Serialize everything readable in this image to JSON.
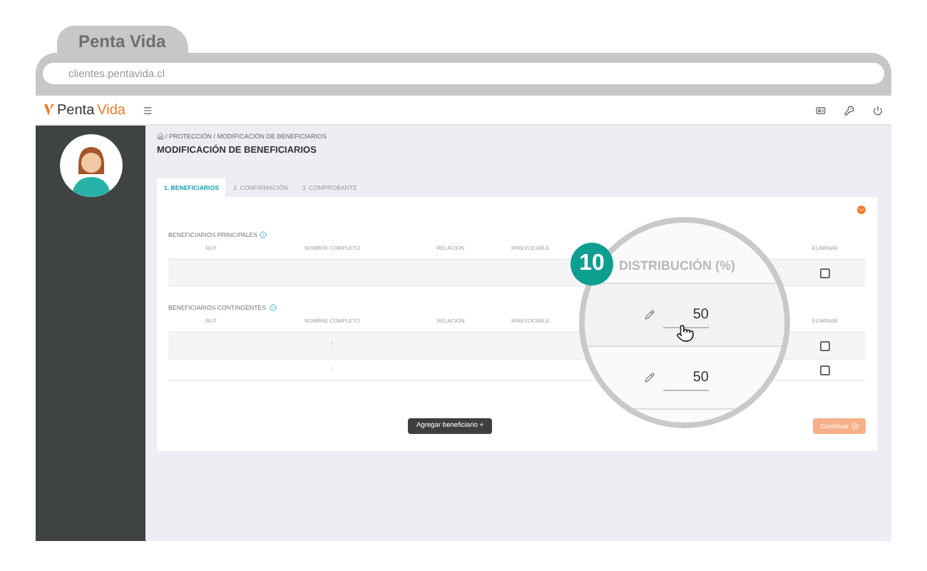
{
  "browser": {
    "tab_title": "Penta Vida",
    "url": "clientes.pentavida.cl"
  },
  "logo": {
    "first": "Penta",
    "second": "Vida"
  },
  "breadcrumb": "/ PROTECCIÓN / MODIFICACIÓN DE BENEFICIARIOS",
  "title": "MODIFICACIÓN DE BENEFICIARIOS",
  "steps": [
    {
      "label": "1. BENEFICIARIOS",
      "selected": true
    },
    {
      "label": "2. CONFIRMACIÓN",
      "selected": false
    },
    {
      "label": "3. COMPROBANTE",
      "selected": false
    }
  ],
  "sections": [
    {
      "title": "BENEFICIARIOS PRINCIPALES",
      "columns": [
        "RUT",
        "NOMBRE COMPLETO",
        "RELACIÓN",
        "IRREVOCABLE",
        "ELIMINAR"
      ],
      "rows": [
        {
          "shaded": true,
          "name": "",
          "checked": false
        }
      ]
    },
    {
      "title": "BENEFICIARIOS CONTINGENTES",
      "columns": [
        "RUT",
        "NOMBRE COMPLETO",
        "RELACIÓN",
        "IRREVOCABLE",
        "ELIMINAR"
      ],
      "rows": [
        {
          "shaded": true,
          "name": ":",
          "checked": false
        },
        {
          "shaded": false,
          "name": ":",
          "checked": false
        }
      ]
    }
  ],
  "add_button": "Agregar beneficiario +",
  "continue_button": {
    "label": "Continuar",
    "disabled": true
  },
  "magnifier": {
    "step": "10",
    "header": "DISTRIBUCIÓN (%)",
    "values": [
      "50",
      "50"
    ]
  }
}
